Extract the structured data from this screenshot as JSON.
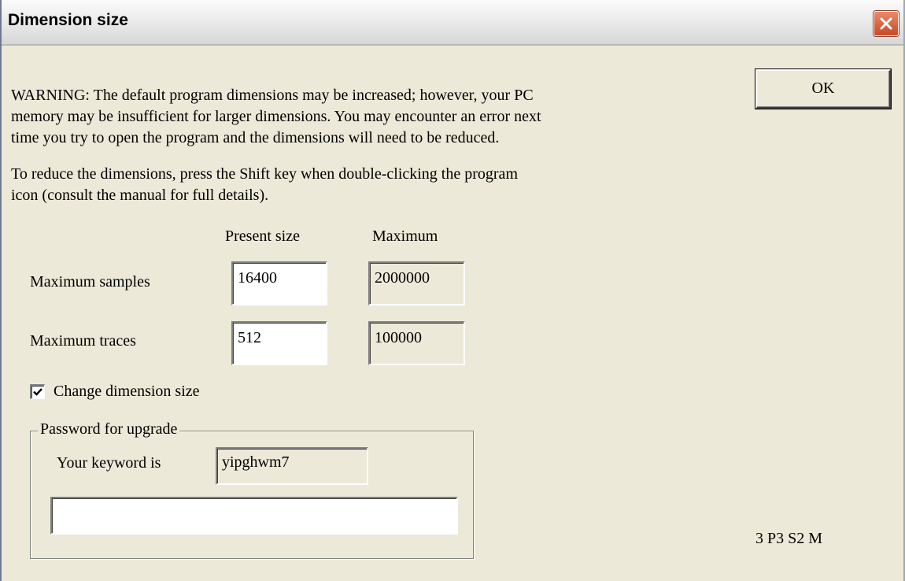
{
  "window": {
    "title": "Dimension size"
  },
  "warning": {
    "lines": [
      "WARNING: The default program dimensions may be increased; however, your PC",
      "memory may be insufficient for larger dimensions. You may encounter an error next",
      "time you try to open the program and the dimensions will need to be reduced."
    ],
    "reduce_lines": [
      "To reduce the dimensions, press the Shift key when double-clicking the program",
      "icon (consult the manual for full details)."
    ]
  },
  "ok_label": "OK",
  "columns": {
    "present": "Present size",
    "maximum": "Maximum"
  },
  "rows": [
    {
      "label": "Maximum samples",
      "present": "16400",
      "maximum": "2000000"
    },
    {
      "label": "Maximum traces",
      "present": "512",
      "maximum": "100000"
    }
  ],
  "change_dimension": {
    "label": "Change dimension size",
    "checked": true
  },
  "password": {
    "group_label": "Password for upgrade",
    "keyword_label": "Your keyword is",
    "keyword_value": "yipghwm7",
    "input_value": ""
  },
  "version_text": "3 P3 S2 M"
}
